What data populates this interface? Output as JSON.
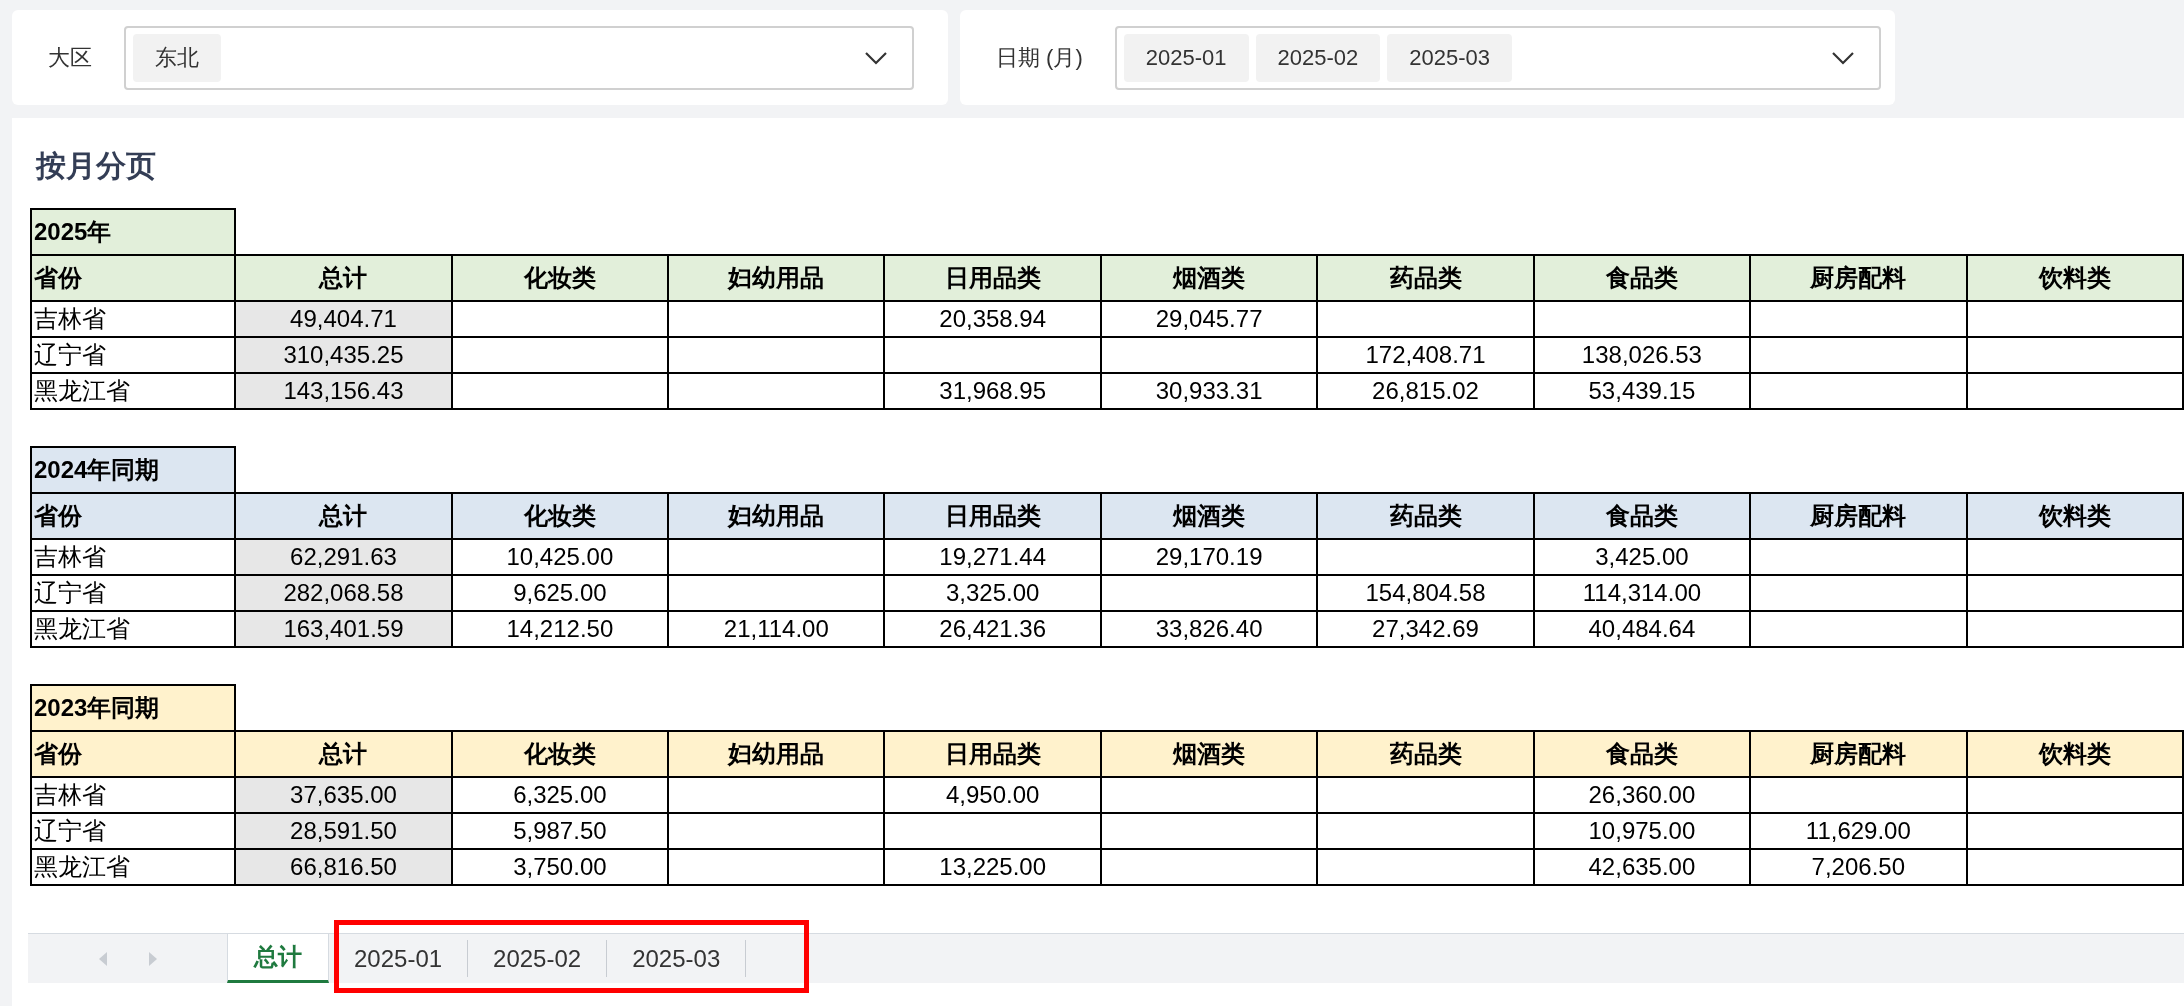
{
  "filters": [
    {
      "label": "大区",
      "tags": [
        "东北"
      ]
    },
    {
      "label": "日期 (月)",
      "tags": [
        "2025-01",
        "2025-02",
        "2025-03"
      ]
    }
  ],
  "report": {
    "title": "按月分页",
    "sections": [
      {
        "title": "2025年",
        "color": "#e2efda",
        "columns": [
          "省份",
          "总计",
          "化妆类",
          "妇幼用品",
          "日用品类",
          "烟酒类",
          "药品类",
          "食品类",
          "厨房配料",
          "饮料类"
        ],
        "rows": [
          [
            "吉林省",
            "49,404.71",
            "",
            "",
            "20,358.94",
            "29,045.77",
            "",
            "",
            "",
            ""
          ],
          [
            "辽宁省",
            "310,435.25",
            "",
            "",
            "",
            "",
            "172,408.71",
            "138,026.53",
            "",
            ""
          ],
          [
            "黑龙江省",
            "143,156.43",
            "",
            "",
            "31,968.95",
            "30,933.31",
            "26,815.02",
            "53,439.15",
            "",
            ""
          ]
        ]
      },
      {
        "title": "2024年同期",
        "color": "#dce6f1",
        "columns": [
          "省份",
          "总计",
          "化妆类",
          "妇幼用品",
          "日用品类",
          "烟酒类",
          "药品类",
          "食品类",
          "厨房配料",
          "饮料类"
        ],
        "rows": [
          [
            "吉林省",
            "62,291.63",
            "10,425.00",
            "",
            "19,271.44",
            "29,170.19",
            "",
            "3,425.00",
            "",
            ""
          ],
          [
            "辽宁省",
            "282,068.58",
            "9,625.00",
            "",
            "3,325.00",
            "",
            "154,804.58",
            "114,314.00",
            "",
            ""
          ],
          [
            "黑龙江省",
            "163,401.59",
            "14,212.50",
            "21,114.00",
            "26,421.36",
            "33,826.40",
            "27,342.69",
            "40,484.64",
            "",
            ""
          ]
        ]
      },
      {
        "title": "2023年同期",
        "color": "#fff2cc",
        "columns": [
          "省份",
          "总计",
          "化妆类",
          "妇幼用品",
          "日用品类",
          "烟酒类",
          "药品类",
          "食品类",
          "厨房配料",
          "饮料类"
        ],
        "rows": [
          [
            "吉林省",
            "37,635.00",
            "6,325.00",
            "",
            "4,950.00",
            "",
            "",
            "26,360.00",
            "",
            ""
          ],
          [
            "辽宁省",
            "28,591.50",
            "5,987.50",
            "",
            "",
            "",
            "",
            "10,975.00",
            "11,629.00",
            ""
          ],
          [
            "黑龙江省",
            "66,816.50",
            "3,750.00",
            "",
            "13,225.00",
            "",
            "",
            "42,635.00",
            "7,206.50",
            ""
          ]
        ]
      }
    ]
  },
  "sheet_tabs": [
    {
      "label": "总计",
      "selected": true
    },
    {
      "label": "2025-01",
      "selected": false
    },
    {
      "label": "2025-02",
      "selected": false
    },
    {
      "label": "2025-03",
      "selected": false
    }
  ]
}
